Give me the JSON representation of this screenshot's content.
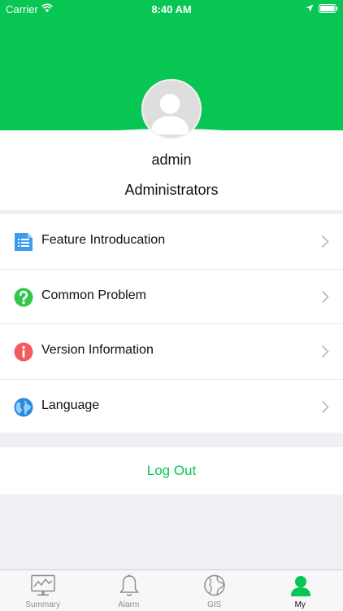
{
  "status_bar": {
    "carrier": "Carrier",
    "time": "8:40 AM"
  },
  "profile": {
    "username": "admin",
    "role": "Administrators"
  },
  "menu": {
    "items": [
      {
        "label": "Feature Introducation",
        "icon": "document-list-icon",
        "color": "#3b9cf2"
      },
      {
        "label": "Common Problem",
        "icon": "question-icon",
        "color": "#32c84a"
      },
      {
        "label": "Version Information",
        "icon": "info-icon",
        "color": "#f65b5b"
      },
      {
        "label": "Language",
        "icon": "globe-icon",
        "color": "#2f86e0"
      }
    ]
  },
  "logout": {
    "label": "Log Out"
  },
  "tabs": [
    {
      "label": "Summary",
      "icon": "chart-monitor-icon",
      "active": false
    },
    {
      "label": "Alarm",
      "icon": "bell-icon",
      "active": false
    },
    {
      "label": "GIS",
      "icon": "globe-icon",
      "active": false
    },
    {
      "label": "My",
      "icon": "person-icon",
      "active": true
    }
  ],
  "colors": {
    "brand": "#07c653",
    "background": "#efeff4"
  }
}
